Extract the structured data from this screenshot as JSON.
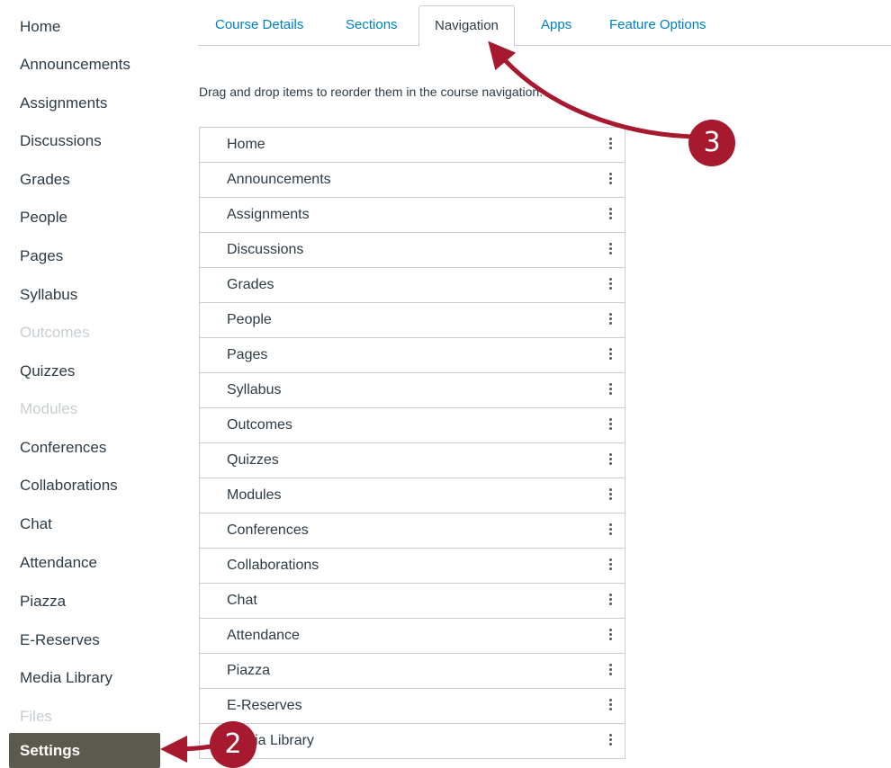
{
  "sidebar": {
    "items": [
      {
        "label": "Home",
        "disabled": false
      },
      {
        "label": "Announcements",
        "disabled": false
      },
      {
        "label": "Assignments",
        "disabled": false
      },
      {
        "label": "Discussions",
        "disabled": false
      },
      {
        "label": "Grades",
        "disabled": false
      },
      {
        "label": "People",
        "disabled": false
      },
      {
        "label": "Pages",
        "disabled": false
      },
      {
        "label": "Syllabus",
        "disabled": false
      },
      {
        "label": "Outcomes",
        "disabled": true
      },
      {
        "label": "Quizzes",
        "disabled": false
      },
      {
        "label": "Modules",
        "disabled": true
      },
      {
        "label": "Conferences",
        "disabled": false
      },
      {
        "label": "Collaborations",
        "disabled": false
      },
      {
        "label": "Chat",
        "disabled": false
      },
      {
        "label": "Attendance",
        "disabled": false
      },
      {
        "label": "Piazza",
        "disabled": false
      },
      {
        "label": "E-Reserves",
        "disabled": false
      },
      {
        "label": "Media Library",
        "disabled": false
      },
      {
        "label": "Files",
        "disabled": true
      }
    ],
    "settings_label": "Settings"
  },
  "tabs": [
    {
      "label": "Course Details",
      "active": false
    },
    {
      "label": "Sections",
      "active": false
    },
    {
      "label": "Navigation",
      "active": true
    },
    {
      "label": "Apps",
      "active": false
    },
    {
      "label": "Feature Options",
      "active": false
    }
  ],
  "help_text": "Drag and drop items to reorder them in the course navigation.",
  "nav_list": [
    "Home",
    "Announcements",
    "Assignments",
    "Discussions",
    "Grades",
    "People",
    "Pages",
    "Syllabus",
    "Outcomes",
    "Quizzes",
    "Modules",
    "Conferences",
    "Collaborations",
    "Chat",
    "Attendance",
    "Piazza",
    "E-Reserves",
    "Media Library"
  ],
  "annotations": {
    "step_2": "2",
    "step_3": "3"
  },
  "colors": {
    "link": "#0081bd",
    "annotation": "#a6192e",
    "settings_bg": "#5c5a4f",
    "disabled": "#c7cdd1"
  }
}
